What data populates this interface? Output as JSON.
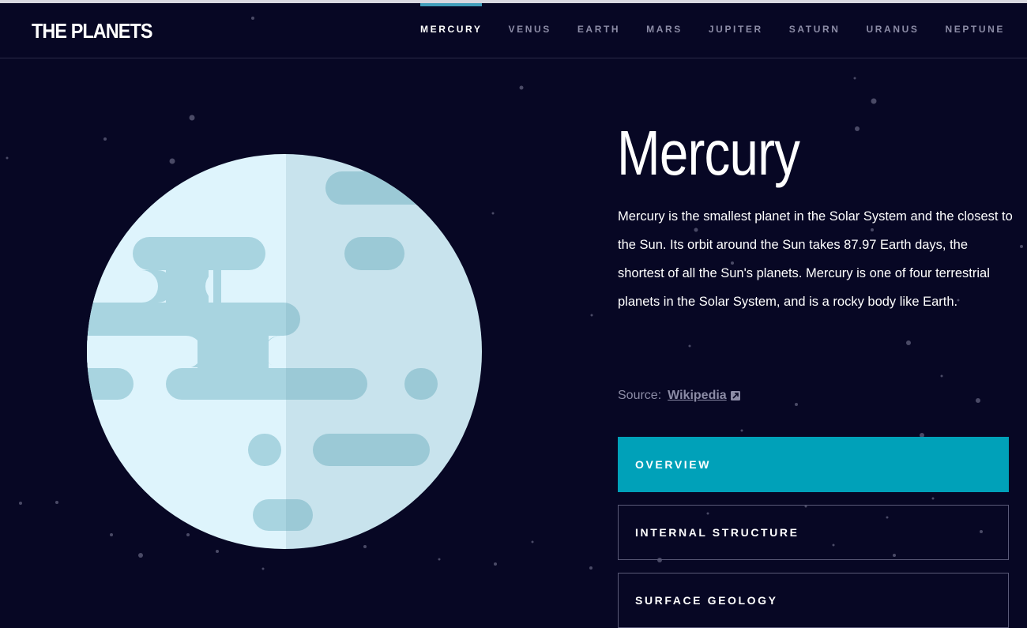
{
  "header": {
    "logo": "THE PLANETS",
    "nav": [
      {
        "label": "MERCURY",
        "active": true
      },
      {
        "label": "VENUS"
      },
      {
        "label": "EARTH"
      },
      {
        "label": "MARS"
      },
      {
        "label": "JUPITER"
      },
      {
        "label": "SATURN"
      },
      {
        "label": "URANUS"
      },
      {
        "label": "NEPTUNE"
      }
    ]
  },
  "planet": {
    "name": "Mercury",
    "description": "Mercury is the smallest planet in the Solar System and the closest to the Sun. Its orbit around the Sun takes 87.97 Earth days, the shortest of all the Sun's planets. Mercury is one of four terrestrial planets in the Solar System, and is a rocky body like Earth.",
    "source_label": "Source:",
    "source_link": "Wikipedia",
    "source_icon": "external-link-icon"
  },
  "tabs": [
    {
      "label": "OVERVIEW",
      "active": true
    },
    {
      "label": "INTERNAL STRUCTURE"
    },
    {
      "label": "SURFACE GEOLOGY"
    }
  ],
  "colors": {
    "background": "#070724",
    "accent": "#419ebb",
    "tab_active": "#00a1b9",
    "muted_text": "#8c8ca6",
    "planet_light": "#def4fc",
    "planet_shade": "#c6e1e8",
    "planet_spots": "#a8d4e0"
  }
}
